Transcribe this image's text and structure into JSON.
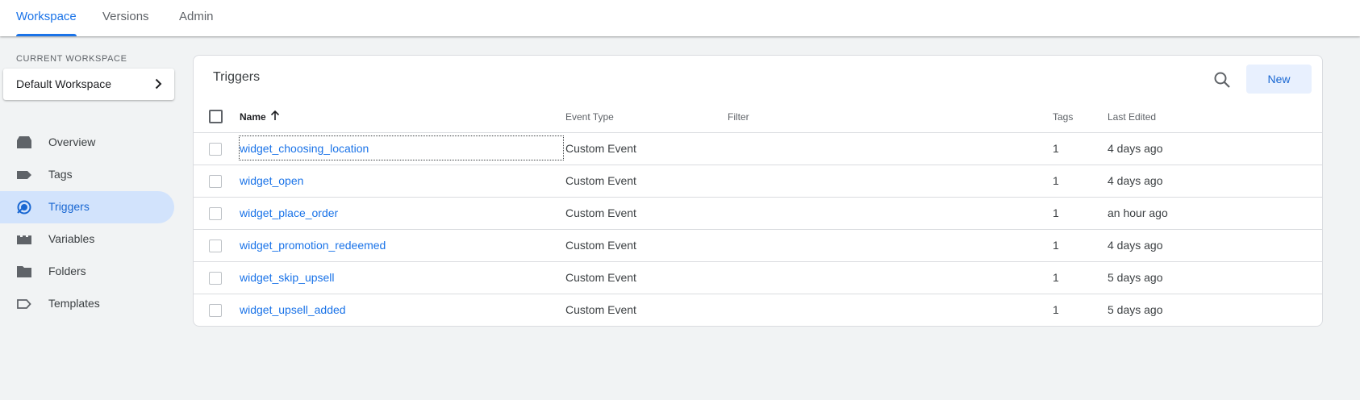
{
  "top_nav": {
    "tabs": [
      {
        "label": "Workspace",
        "active": true
      },
      {
        "label": "Versions",
        "active": false
      },
      {
        "label": "Admin",
        "active": false
      }
    ]
  },
  "sidebar": {
    "current_workspace_label": "CURRENT WORKSPACE",
    "workspace_name": "Default Workspace",
    "items": [
      {
        "label": "Overview",
        "icon": "overview-icon",
        "active": false
      },
      {
        "label": "Tags",
        "icon": "tag-icon",
        "active": false
      },
      {
        "label": "Triggers",
        "icon": "trigger-icon",
        "active": true
      },
      {
        "label": "Variables",
        "icon": "variables-icon",
        "active": false
      },
      {
        "label": "Folders",
        "icon": "folder-icon",
        "active": false
      },
      {
        "label": "Templates",
        "icon": "template-icon",
        "active": false
      }
    ]
  },
  "main": {
    "title": "Triggers",
    "new_button": "New",
    "columns": {
      "name": "Name",
      "event_type": "Event Type",
      "filter": "Filter",
      "tags": "Tags",
      "last_edited": "Last Edited"
    },
    "sort": {
      "column": "Name",
      "direction": "ascending"
    },
    "rows": [
      {
        "name": "widget_choosing_location",
        "event_type": "Custom Event",
        "filter": "",
        "tags": "1",
        "last_edited": "4 days ago"
      },
      {
        "name": "widget_open",
        "event_type": "Custom Event",
        "filter": "",
        "tags": "1",
        "last_edited": "4 days ago"
      },
      {
        "name": "widget_place_order",
        "event_type": "Custom Event",
        "filter": "",
        "tags": "1",
        "last_edited": "an hour ago"
      },
      {
        "name": "widget_promotion_redeemed",
        "event_type": "Custom Event",
        "filter": "",
        "tags": "1",
        "last_edited": "4 days ago"
      },
      {
        "name": "widget_skip_upsell",
        "event_type": "Custom Event",
        "filter": "",
        "tags": "1",
        "last_edited": "5 days ago"
      },
      {
        "name": "widget_upsell_added",
        "event_type": "Custom Event",
        "filter": "",
        "tags": "1",
        "last_edited": "5 days ago"
      }
    ]
  },
  "colors": {
    "accent": "#1a73e8",
    "active_nav_bg": "#d2e3fc",
    "page_bg": "#f1f3f4",
    "new_button_bg": "#e8f0fe"
  }
}
